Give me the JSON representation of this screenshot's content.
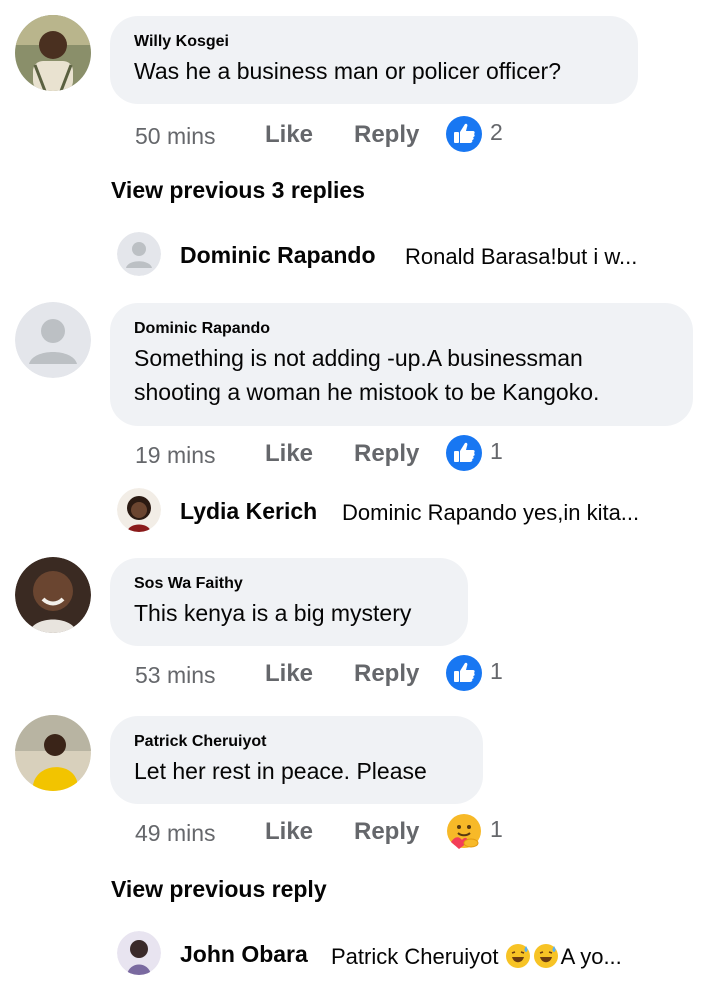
{
  "comments": [
    {
      "author": "Willy Kosgei",
      "text": [
        "Was he a business man or policer officer?"
      ],
      "time": "50 mins",
      "like": "Like",
      "reply": "Reply",
      "reaction": "like",
      "reaction_count": "2"
    },
    {
      "author": "Dominic Rapando",
      "text": [
        "Something is not adding -up.A businessman",
        "shooting a woman he mistook to be  Kangoko."
      ],
      "time": "19 mins",
      "like": "Like",
      "reply": "Reply",
      "reaction": "like",
      "reaction_count": "1"
    },
    {
      "author": "Sos Wa Faithy",
      "text": [
        "This kenya is a big mystery"
      ],
      "time": "53 mins",
      "like": "Like",
      "reply": "Reply",
      "reaction": "like",
      "reaction_count": "1"
    },
    {
      "author": "Patrick Cheruiyot",
      "text": [
        "Let her rest in peace. Please"
      ],
      "time": "49 mins",
      "like": "Like",
      "reply": "Reply",
      "reaction": "care",
      "reaction_count": "1"
    }
  ],
  "view_previous": [
    "View previous 3 replies",
    "View previous reply"
  ],
  "replies": [
    {
      "author": "Dominic Rapando",
      "preview": "Ronald Barasa!but i w..."
    },
    {
      "author": "Lydia Kerich",
      "preview": "Dominic Rapando yes,in kita..."
    },
    {
      "author": "John Obara",
      "preview_before": "Patrick Cheruiyot",
      "preview_emojis": [
        "grinning-sweat-emoji",
        "grinning-sweat-emoji"
      ],
      "preview_after": "A yo..."
    }
  ],
  "colors": {
    "bubble": "#f0f2f5",
    "secondary_text": "#65676b",
    "like_blue": "#1877f2",
    "primary_text": "#050505"
  }
}
